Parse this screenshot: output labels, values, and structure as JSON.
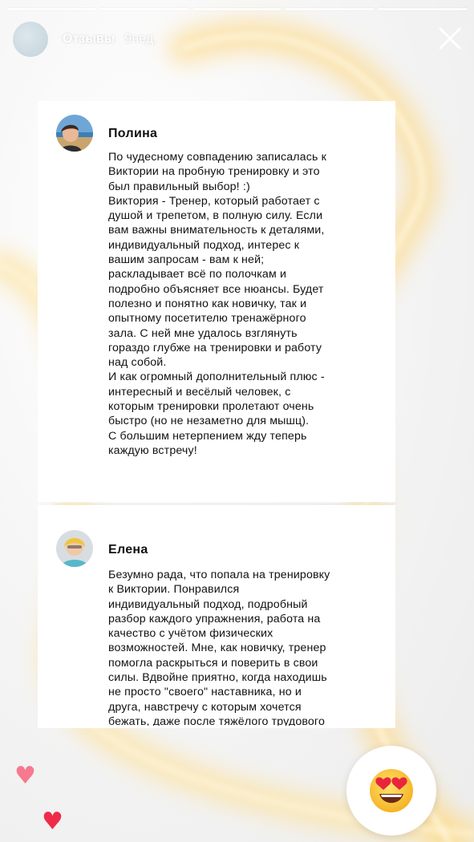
{
  "story": {
    "title": "Отзывы",
    "time": "9нед.",
    "progress_segments": 5
  },
  "reviews": [
    {
      "name": "Полина",
      "text": "По чудесному совпадению записалась к\nВиктории на пробную тренировку и это\nбыл правильный выбор! :)\nВиктория - Тренер, который работает с\nдушой и трепетом, в полную силу. Если\nвам важны внимательность к деталями,\nиндивидуальный подход, интерес к\nвашим запросам - вам к ней;\nраскладывает всё по полочкам и\nподробно объясняет все нюансы. Будет\nполезно и понятно как новичку, так и\nопытному посетителю тренажёрного\nзала. С ней мне удалось взглянуть\nгораздо глубже на тренировки и работу\nнад собой.\nИ как огромный дополнительный плюс -\nинтересный и весёлый человек, с\nкоторым тренировки пролетают очень\nбыстро (но не незаметно для мышц).\nС большим нетерпением жду теперь\nкаждую встречу!"
    },
    {
      "name": "Елена",
      "text": "Безумно рада, что попала на тренировку\nк Виктории. Понравился\nиндивидуальный подход, подробный\nразбор каждого упражнения, работа на\nкачество с учётом физических\nвозможностей. Мне, как новичку, тренер\nпомогла раскрыться и поверить в свои\nсилы. Вдвойне приятно, когда находишь\nне просто \"своего\" наставника, но и\nдруга, навстречу с которым хочется\nбежать, даже после тяжёлого трудового"
    }
  ],
  "reactions": {
    "emoji_button": "heart-eyes-emoji",
    "heart_light_color": "#f6798f",
    "heart_dark_color": "#ef2b4a"
  }
}
